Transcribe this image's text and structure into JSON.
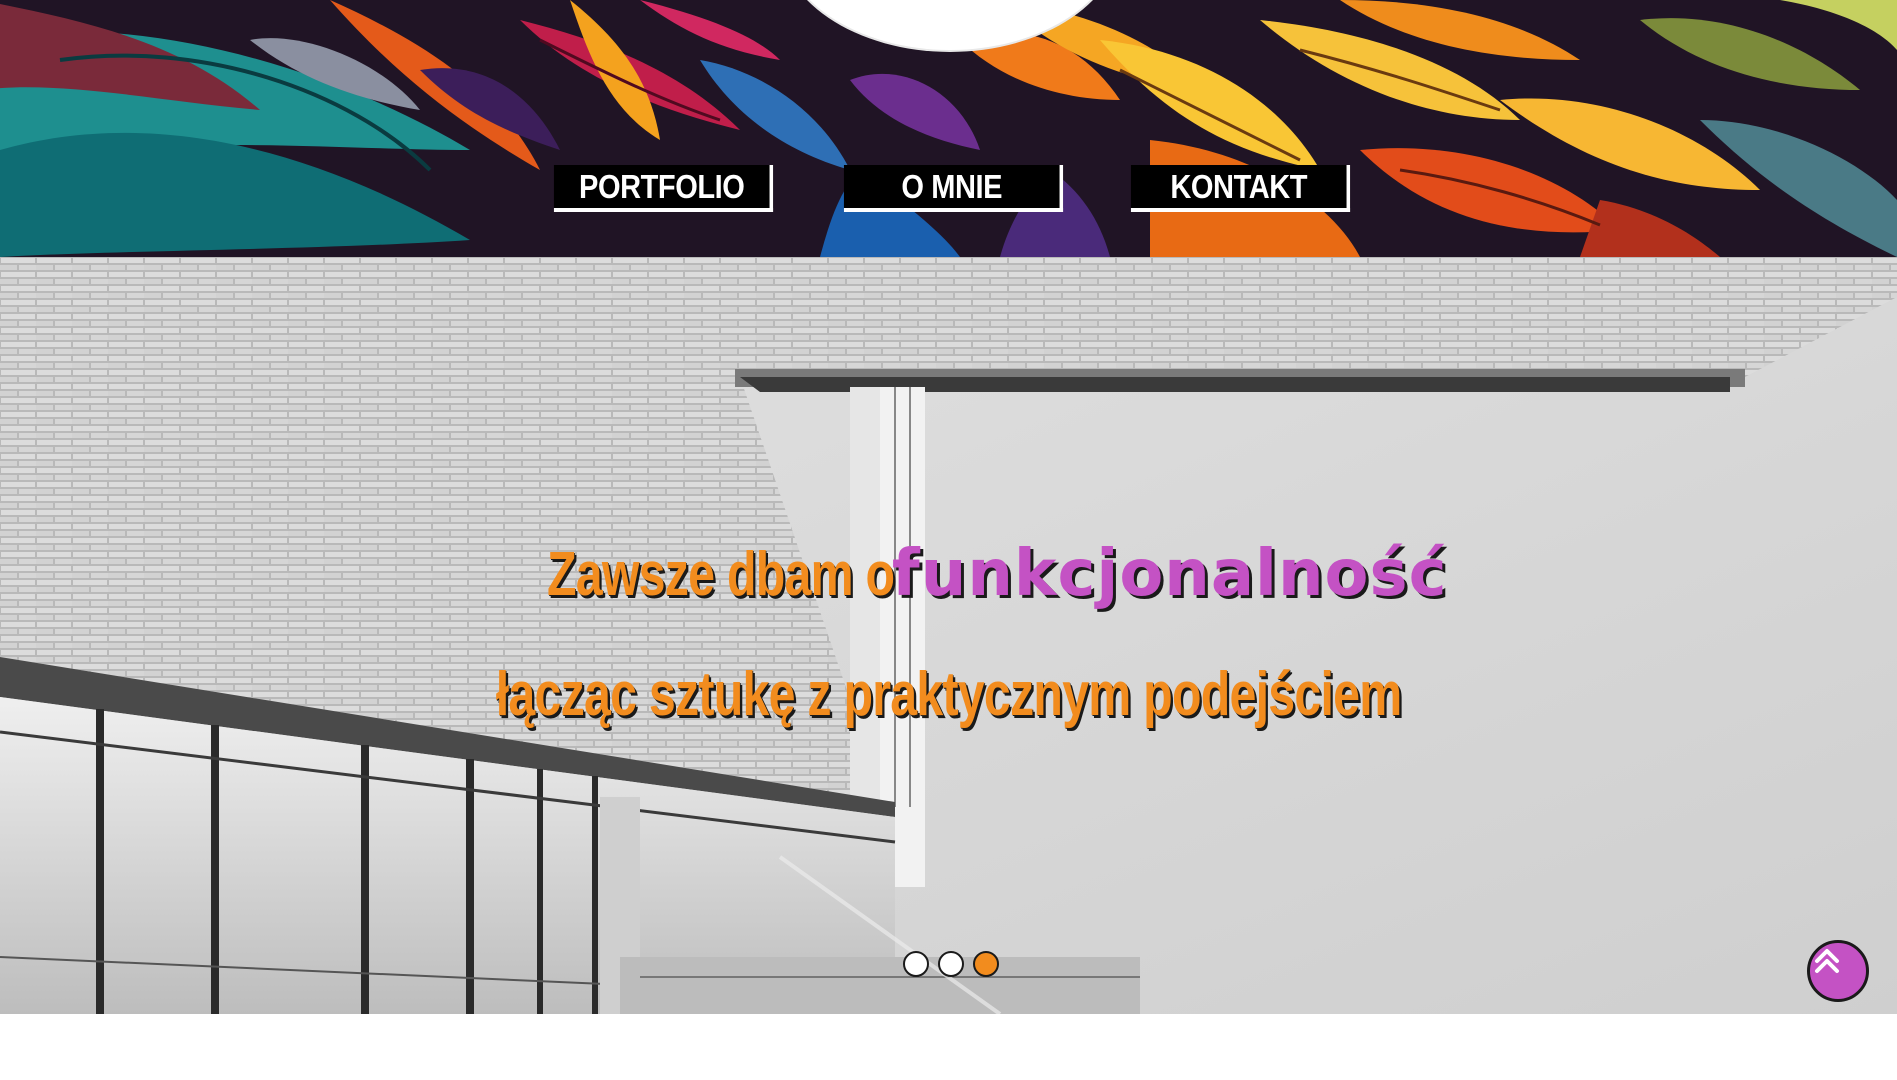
{
  "nav": {
    "items": [
      {
        "label": "PORTFOLIO"
      },
      {
        "label": "O MNIE"
      },
      {
        "label": "KONTAKT"
      }
    ]
  },
  "hero": {
    "line1_main": "Zawsze dbam o",
    "line1_accent": "funkcjonalność",
    "line2": "łącząc sztukę z praktycznym podejściem",
    "slides_total": 3,
    "active_slide": 3
  },
  "colors": {
    "accent_orange": "#f28c1e",
    "accent_purple": "#c452c4",
    "nav_bg": "#000000",
    "nav_text": "#ffffff"
  },
  "icons": {
    "scroll_top": "double-chevron-up-icon"
  }
}
